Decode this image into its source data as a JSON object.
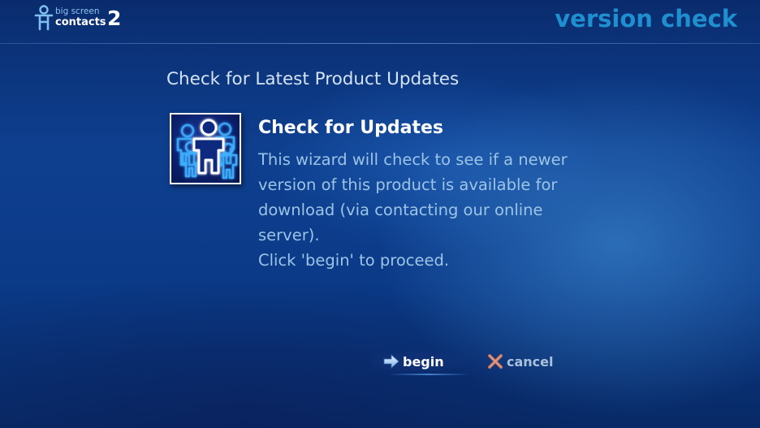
{
  "header": {
    "logo": {
      "small_text": "big screen",
      "main_text": "contacts",
      "version_number": "2"
    },
    "page_heading": "version check"
  },
  "main": {
    "section_title": "Check for Latest Product Updates",
    "wizard": {
      "icon": "people-group-icon",
      "title": "Check for Updates",
      "description_lines": [
        "This wizard will check to see if a newer",
        "version of this product is available for",
        "download (via contacting our online",
        "server)."
      ],
      "hint": "Click 'begin' to proceed."
    }
  },
  "actions": {
    "begin_label": "begin",
    "begin_icon": "arrow-right-icon",
    "cancel_label": "cancel",
    "cancel_icon": "x-icon"
  },
  "colors": {
    "background": "#0e3f8f",
    "heading": "#1f8fcf",
    "body_text": "#9cc4e6",
    "title_text": "#ffffff",
    "cancel_icon": "#c0705a"
  }
}
